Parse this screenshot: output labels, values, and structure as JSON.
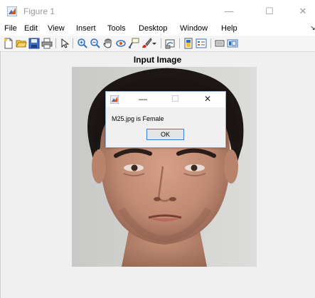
{
  "window": {
    "title": "Figure 1",
    "minimize": "—",
    "maximize": "☐",
    "close": "✕"
  },
  "menu": {
    "items": [
      "File",
      "Edit",
      "View",
      "Insert",
      "Tools",
      "Desktop",
      "Window",
      "Help"
    ],
    "overflow": "↘"
  },
  "toolbar": {
    "icons": [
      "new-figure-icon",
      "open-file-icon",
      "save-icon",
      "print-icon",
      "select-arrow-icon",
      "zoom-in-icon",
      "zoom-out-icon",
      "pan-hand-icon",
      "rotate-3d-icon",
      "data-cursor-icon",
      "brush-icon",
      "brush-dropdown-icon",
      "link-plot-icon",
      "colorbar-icon",
      "legend-icon",
      "hide-plot-tools-icon",
      "show-plot-tools-icon"
    ]
  },
  "axes": {
    "title": "Input Image"
  },
  "dialog": {
    "minimize": "—",
    "maximize": "☐",
    "close": "✕",
    "message": "M25.jpg is Female",
    "ok_label": "OK"
  }
}
